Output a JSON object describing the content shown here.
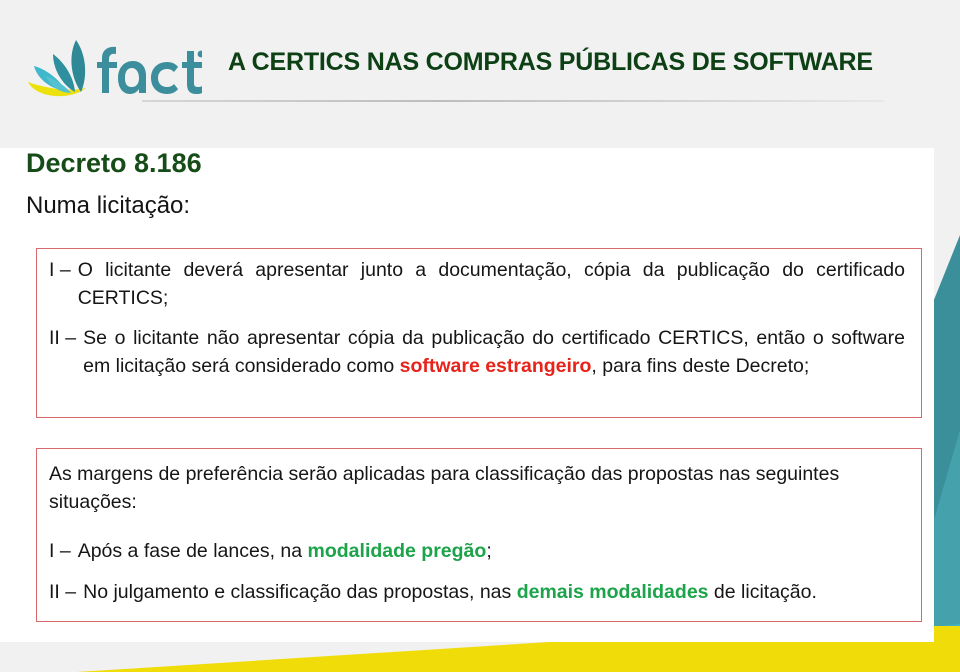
{
  "header": {
    "logo_alt": "Facti",
    "logo_wordmark": "Facti",
    "title": "A CERTICS NAS COMPRAS PÚBLICAS DE SOFTWARE"
  },
  "content": {
    "decreto_heading": "Decreto 8.186",
    "intro": "Numa licitação:",
    "box1": {
      "items": [
        {
          "marker": "I –",
          "text_before": "O licitante deverá apresentar junto a documentação, cópia da publicação do certificado CERTICS;",
          "highlight": "",
          "text_after": ""
        },
        {
          "marker": "II –",
          "text_before": "Se o licitante não apresentar cópia da publicação do certificado CERTICS, então o software em licitação será considerado como ",
          "highlight": "software estrangeiro",
          "text_after": ", para fins deste Decreto;"
        }
      ]
    },
    "box2": {
      "lead": "As margens de preferência serão aplicadas para classificação das propostas nas seguintes situações:",
      "items": [
        {
          "marker": "I –",
          "text_before": "Após a fase de lances, na ",
          "highlight": "modalidade pregão",
          "text_after": ";"
        },
        {
          "marker": "II –",
          "text_before": "No julgamento e classificação das propostas, nas ",
          "highlight": "demais modalidades",
          "text_after": " de licitação."
        }
      ]
    }
  },
  "colors": {
    "title_green": "#0d4014",
    "heading_green": "#164c18",
    "highlight_red": "#e8231b",
    "highlight_green": "#1da34a",
    "box_border_red": "#d66a6a",
    "deco_teal": "#45b3c4",
    "deco_yellow": "#efdc09",
    "page_background": "#f1f1f1"
  }
}
